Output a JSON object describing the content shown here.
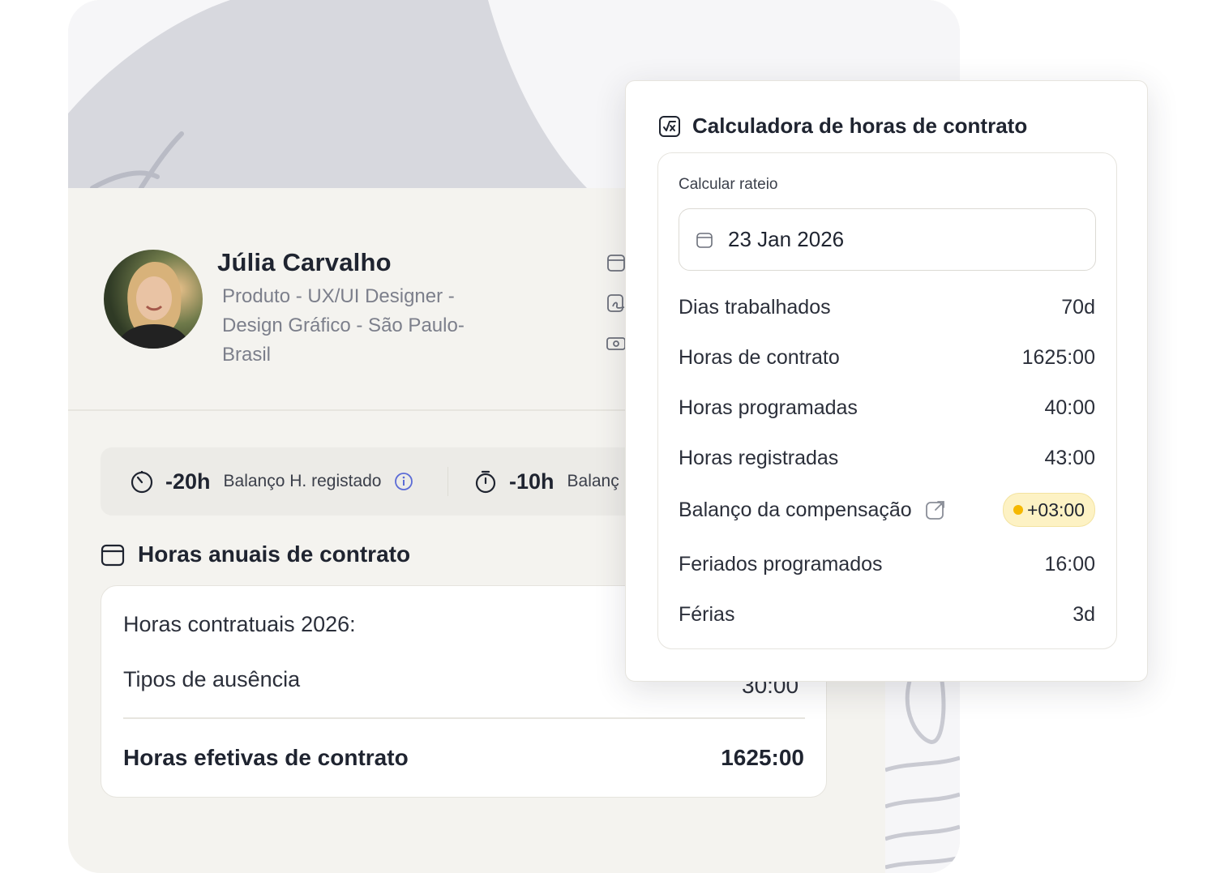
{
  "profile": {
    "name": "Júlia Carvalho",
    "subtitle": "Produto - UX/UI Designer - Design Gráfico - São Paulo- Brasil"
  },
  "balances": [
    {
      "value": "-20h",
      "label": "Balanço H. registado"
    },
    {
      "value": "-10h",
      "label": "Balanç"
    }
  ],
  "annual": {
    "title": "Horas anuais de contrato",
    "rows": [
      {
        "label": "Horas contratuais 2026:"
      },
      {
        "label": "Tipos de ausência",
        "value": "30:00"
      }
    ],
    "total_label": "Horas efetivas de contrato",
    "total_value": "1625:00"
  },
  "calculator": {
    "title": "Calculadora de horas de contrato",
    "subtitle": "Calcular rateio",
    "date_value": "23 Jan 2026",
    "rows": [
      {
        "label": "Dias trabalhados",
        "value": "70d"
      },
      {
        "label": "Horas de contrato",
        "value": "1625:00"
      },
      {
        "label": "Horas programadas",
        "value": "40:00"
      },
      {
        "label": "Horas registradas",
        "value": "43:00"
      },
      {
        "label": "Balanço da compensação",
        "value": "+03:00"
      },
      {
        "label": "Feriados programados",
        "value": "16:00"
      },
      {
        "label": "Férias",
        "value": "3d"
      }
    ]
  },
  "colors": {
    "badge_bg": "#fdf2c4",
    "badge_dot": "#f5b800",
    "info_icon": "#5b6bd6",
    "banner": "#d7d8de"
  },
  "icons": [
    "calendar-icon",
    "signature-icon",
    "cash-icon",
    "stopwatch-icon",
    "info-icon",
    "calculator-icon",
    "external-link-icon"
  ]
}
